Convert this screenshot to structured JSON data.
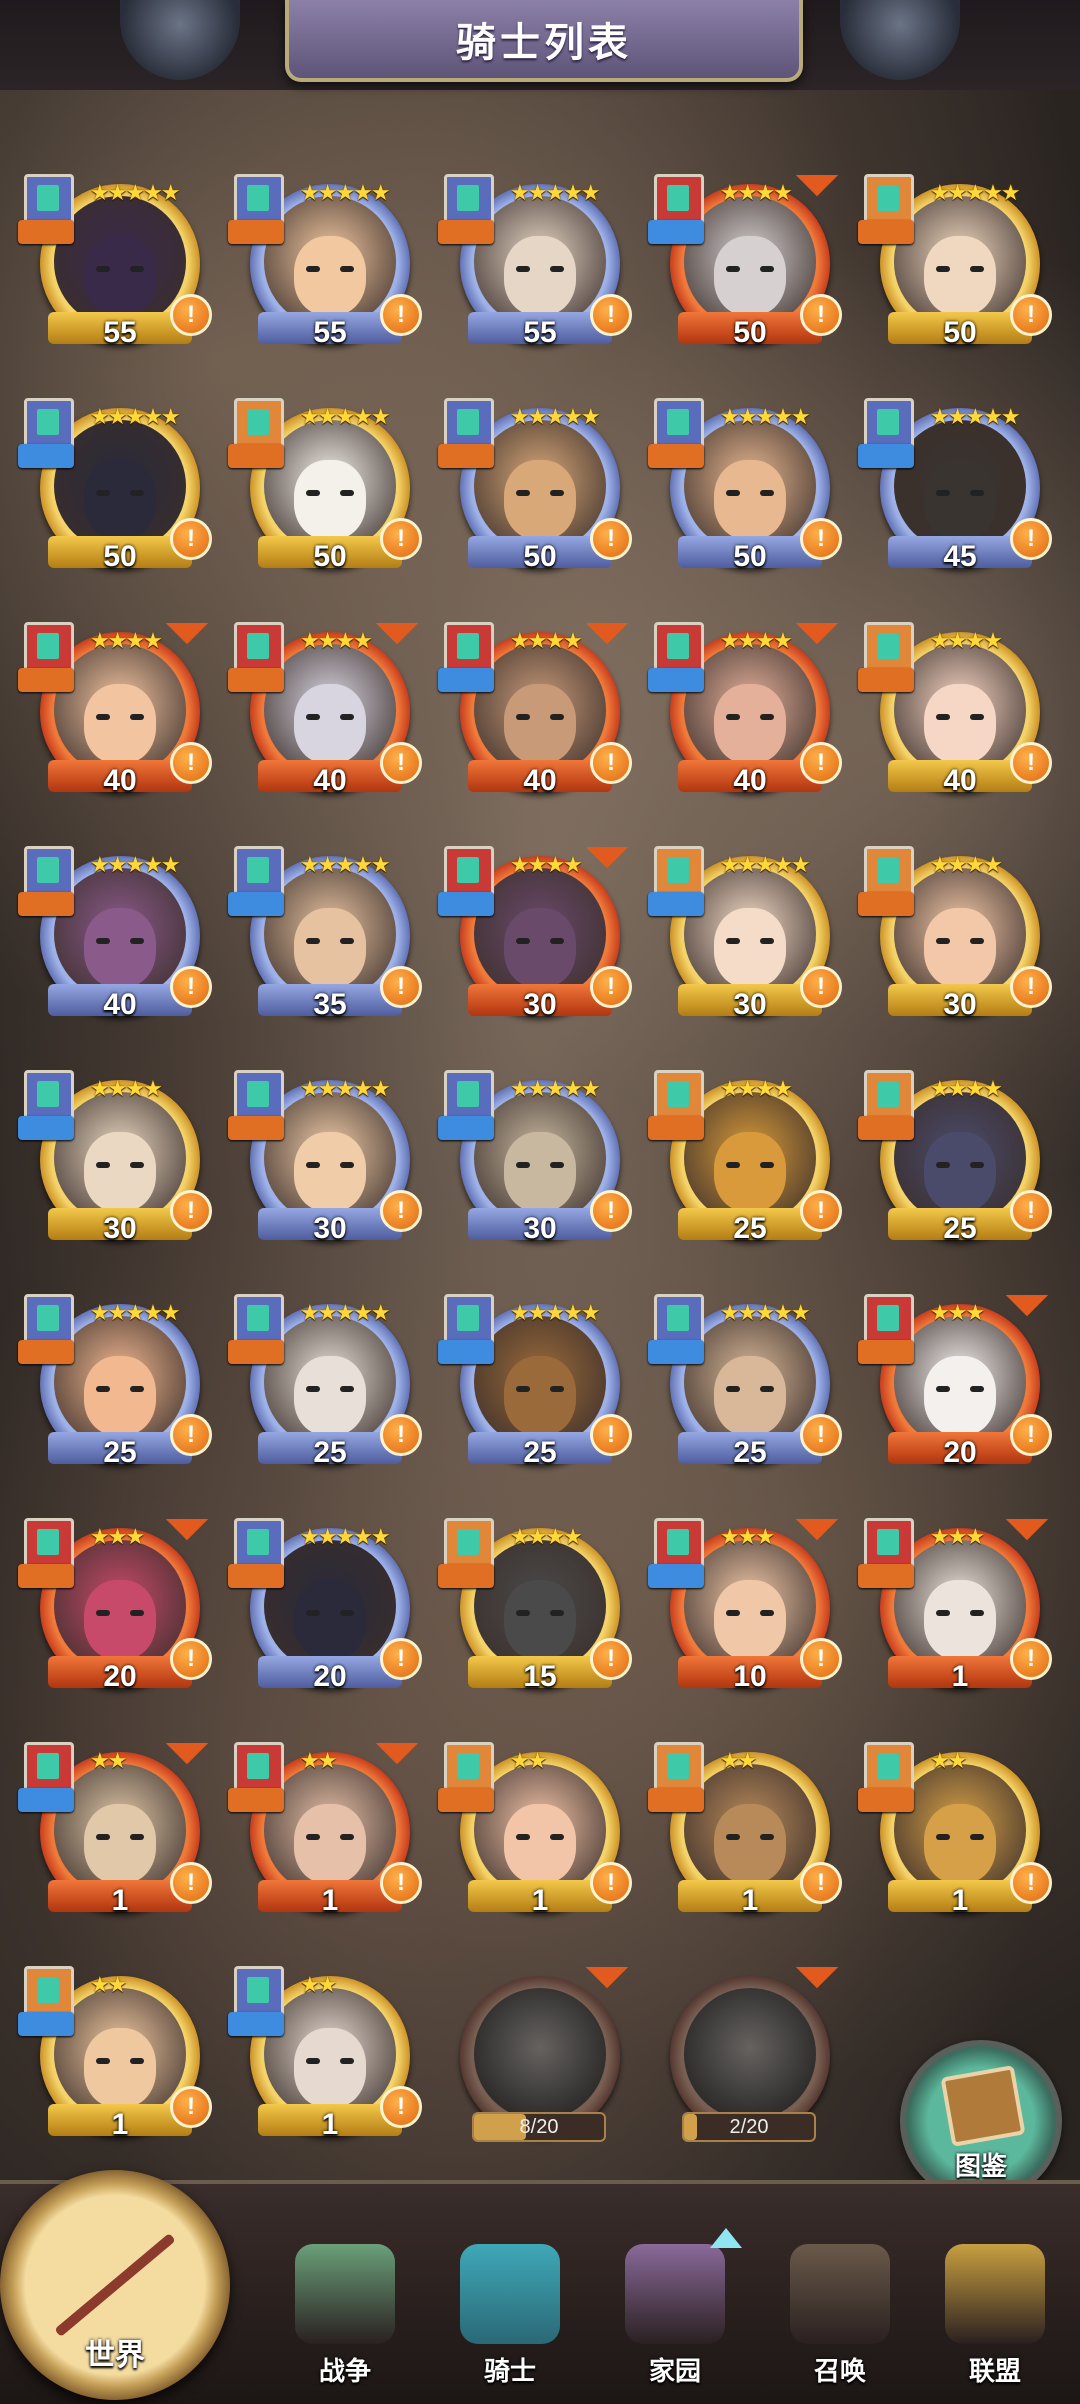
{
  "header": {
    "title": "骑士列表"
  },
  "knights": [
    {
      "level": "55",
      "stars": "★★★★★",
      "frame": "gold",
      "role": "orange",
      "rank": "blue",
      "ribbon": false,
      "skin": "#3a2a4a"
    },
    {
      "level": "55",
      "stars": "★★★★★",
      "frame": "blue",
      "role": "orange",
      "rank": "blue",
      "ribbon": false,
      "skin": "#f2c8a0"
    },
    {
      "level": "55",
      "stars": "★★★★★",
      "frame": "blue",
      "role": "orange",
      "rank": "blue",
      "ribbon": false,
      "skin": "#e6d6c6"
    },
    {
      "level": "50",
      "stars": "★★★★",
      "frame": "red",
      "role": "blue",
      "rank": "red",
      "ribbon": true,
      "skin": "#d6d0d0"
    },
    {
      "level": "50",
      "stars": "★★★★★",
      "frame": "gold",
      "role": "orange",
      "rank": "orange",
      "ribbon": false,
      "skin": "#f0d8c0"
    },
    {
      "level": "50",
      "stars": "★★★★★",
      "frame": "gold",
      "role": "blue",
      "rank": "blue",
      "ribbon": false,
      "skin": "#2a2a3a"
    },
    {
      "level": "50",
      "stars": "★★★★★",
      "frame": "gold",
      "role": "orange",
      "rank": "orange",
      "ribbon": false,
      "skin": "#f4f0ea"
    },
    {
      "level": "50",
      "stars": "★★★★★",
      "frame": "blue",
      "role": "orange",
      "rank": "blue",
      "ribbon": false,
      "skin": "#d8a878"
    },
    {
      "level": "50",
      "stars": "★★★★★",
      "frame": "blue",
      "role": "orange",
      "rank": "blue",
      "ribbon": false,
      "skin": "#e8b890"
    },
    {
      "level": "45",
      "stars": "★★★★★",
      "frame": "blue",
      "role": "blue",
      "rank": "blue",
      "ribbon": false,
      "skin": "#3a3430"
    },
    {
      "level": "40",
      "stars": "★★★★",
      "frame": "red",
      "role": "orange",
      "rank": "red",
      "ribbon": true,
      "skin": "#f2c4a0"
    },
    {
      "level": "40",
      "stars": "★★★★",
      "frame": "red",
      "role": "orange",
      "rank": "red",
      "ribbon": true,
      "skin": "#d8d4e0"
    },
    {
      "level": "40",
      "stars": "★★★★",
      "frame": "red",
      "role": "blue",
      "rank": "red",
      "ribbon": true,
      "skin": "#c89a78"
    },
    {
      "level": "40",
      "stars": "★★★★",
      "frame": "red",
      "role": "blue",
      "rank": "red",
      "ribbon": true,
      "skin": "#e4b09a"
    },
    {
      "level": "40",
      "stars": "★★★★",
      "frame": "gold",
      "role": "orange",
      "rank": "orange",
      "ribbon": false,
      "skin": "#f6d6c4"
    },
    {
      "level": "40",
      "stars": "★★★★★",
      "frame": "blue",
      "role": "orange",
      "rank": "blue",
      "ribbon": false,
      "skin": "#8a5a8a"
    },
    {
      "level": "35",
      "stars": "★★★★★",
      "frame": "blue",
      "role": "blue",
      "rank": "blue",
      "ribbon": false,
      "skin": "#e6c2a0"
    },
    {
      "level": "30",
      "stars": "★★★★",
      "frame": "red",
      "role": "blue",
      "rank": "red",
      "ribbon": true,
      "skin": "#6a4a6a"
    },
    {
      "level": "30",
      "stars": "★★★★★",
      "frame": "gold",
      "role": "blue",
      "rank": "orange",
      "ribbon": false,
      "skin": "#f4dcc8"
    },
    {
      "level": "30",
      "stars": "★★★★",
      "frame": "gold",
      "role": "orange",
      "rank": "orange",
      "ribbon": false,
      "skin": "#f2c8a8"
    },
    {
      "level": "30",
      "stars": "★★★★",
      "frame": "gold",
      "role": "blue",
      "rank": "blue",
      "ribbon": false,
      "skin": "#ead8c2"
    },
    {
      "level": "30",
      "stars": "★★★★★",
      "frame": "blue",
      "role": "orange",
      "rank": "blue",
      "ribbon": false,
      "skin": "#f0cca8"
    },
    {
      "level": "30",
      "stars": "★★★★★",
      "frame": "blue",
      "role": "blue",
      "rank": "blue",
      "ribbon": false,
      "skin": "#c8b8a0"
    },
    {
      "level": "25",
      "stars": "★★★★",
      "frame": "gold",
      "role": "orange",
      "rank": "orange",
      "ribbon": false,
      "skin": "#d89a3a"
    },
    {
      "level": "25",
      "stars": "★★★★",
      "frame": "gold",
      "role": "orange",
      "rank": "orange",
      "ribbon": false,
      "skin": "#4a4a6a"
    },
    {
      "level": "25",
      "stars": "★★★★★",
      "frame": "blue",
      "role": "orange",
      "rank": "blue",
      "ribbon": false,
      "skin": "#f2b890"
    },
    {
      "level": "25",
      "stars": "★★★★★",
      "frame": "blue",
      "role": "orange",
      "rank": "blue",
      "ribbon": false,
      "skin": "#e8e0d8"
    },
    {
      "level": "25",
      "stars": "★★★★★",
      "frame": "blue",
      "role": "blue",
      "rank": "blue",
      "ribbon": false,
      "skin": "#9a6a3a"
    },
    {
      "level": "25",
      "stars": "★★★★★",
      "frame": "blue",
      "role": "blue",
      "rank": "blue",
      "ribbon": false,
      "skin": "#d8b898"
    },
    {
      "level": "20",
      "stars": "★★★",
      "frame": "red",
      "role": "orange",
      "rank": "red",
      "ribbon": true,
      "skin": "#f4f0ee"
    },
    {
      "level": "20",
      "stars": "★★★",
      "frame": "red",
      "role": "orange",
      "rank": "red",
      "ribbon": true,
      "skin": "#c84a6a"
    },
    {
      "level": "20",
      "stars": "★★★★★",
      "frame": "blue",
      "role": "orange",
      "rank": "blue",
      "ribbon": false,
      "skin": "#2a2a3a"
    },
    {
      "level": "15",
      "stars": "★★★★",
      "frame": "gold",
      "role": "orange",
      "rank": "orange",
      "ribbon": false,
      "skin": "#4a4a4a"
    },
    {
      "level": "10",
      "stars": "★★★",
      "frame": "red",
      "role": "blue",
      "rank": "red",
      "ribbon": true,
      "skin": "#f0c8a8"
    },
    {
      "level": "1",
      "stars": "★★★",
      "frame": "red",
      "role": "orange",
      "rank": "red",
      "ribbon": true,
      "skin": "#ece4dc"
    },
    {
      "level": "1",
      "stars": "★★",
      "frame": "red",
      "role": "blue",
      "rank": "red",
      "ribbon": true,
      "skin": "#e0c8a8"
    },
    {
      "level": "1",
      "stars": "★★",
      "frame": "red",
      "role": "orange",
      "rank": "red",
      "ribbon": true,
      "skin": "#e6c0a8"
    },
    {
      "level": "1",
      "stars": "★★",
      "frame": "gold",
      "role": "orange",
      "rank": "orange",
      "ribbon": false,
      "skin": "#f2c4a8"
    },
    {
      "level": "1",
      "stars": "★★",
      "frame": "gold",
      "role": "orange",
      "rank": "orange",
      "ribbon": false,
      "skin": "#b88a5a"
    },
    {
      "level": "1",
      "stars": "★★",
      "frame": "gold",
      "role": "orange",
      "rank": "orange",
      "ribbon": false,
      "skin": "#d6a048"
    },
    {
      "level": "1",
      "stars": "★★",
      "frame": "gold",
      "role": "blue",
      "rank": "orange",
      "ribbon": false,
      "skin": "#f0c8a0"
    },
    {
      "level": "1",
      "stars": "★★",
      "frame": "gold",
      "role": "blue",
      "rank": "blue",
      "ribbon": false,
      "skin": "#e6dad0"
    }
  ],
  "locked_knights": [
    {
      "progress_text": "8/20",
      "progress": 0.4
    },
    {
      "progress_text": "2/20",
      "progress": 0.1
    }
  ],
  "codex": {
    "label": "图鉴"
  },
  "nav": {
    "world": "世界",
    "items": [
      {
        "label": "战争",
        "icon": "war-map-icon",
        "active": false
      },
      {
        "label": "骑士",
        "icon": "knight-icon",
        "active": true
      },
      {
        "label": "家园",
        "icon": "home-icon",
        "active": false
      },
      {
        "label": "召唤",
        "icon": "train-icon",
        "active": false
      },
      {
        "label": "联盟",
        "icon": "alliance-icon",
        "active": false
      }
    ]
  }
}
